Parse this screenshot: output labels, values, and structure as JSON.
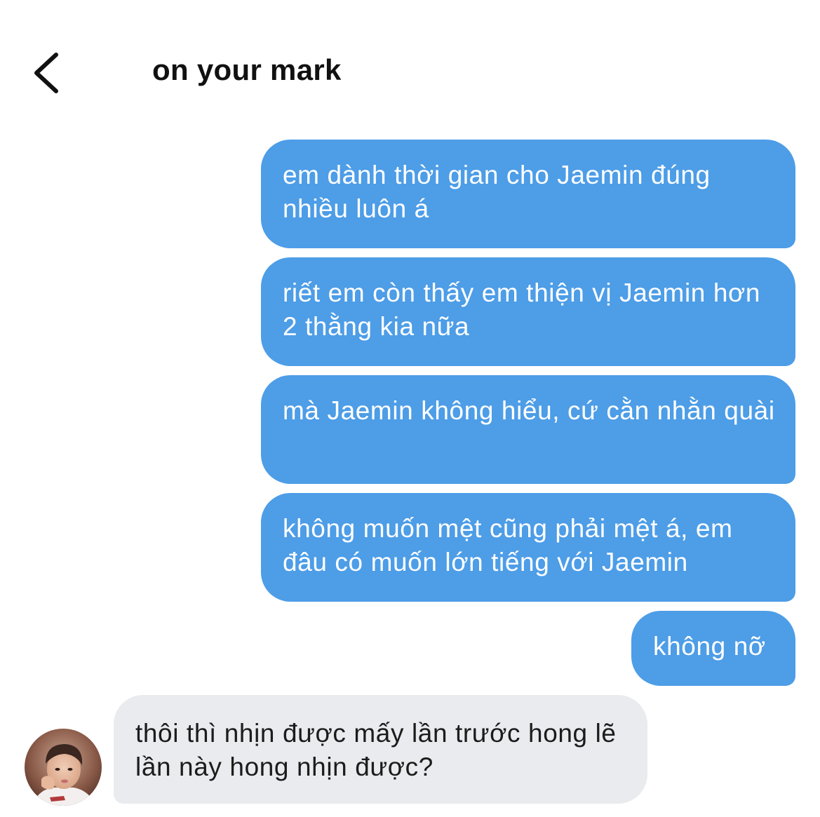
{
  "header": {
    "title": "on your mark",
    "back_icon": "chevron-left-icon"
  },
  "messages": [
    {
      "direction": "sent",
      "text": "em dành thời gian cho Jaemin đúng nhiều luôn á"
    },
    {
      "direction": "sent",
      "text": "riết em còn thấy em thiện vị Jaemin hơn 2 thằng kia nữa"
    },
    {
      "direction": "sent",
      "text": "mà Jaemin không hiểu, cứ cằn nhằn quài"
    },
    {
      "direction": "sent",
      "text": "không muốn mệt cũng phải mệt á, em đâu có muốn lớn tiếng với Jaemin"
    },
    {
      "direction": "sent",
      "text": "không nỡ"
    },
    {
      "direction": "received",
      "text": "thôi thì nhịn được mấy lần trước hong lẽ lần này hong nhịn được?"
    }
  ],
  "colors": {
    "sent_bubble": "#4d9de7",
    "received_bubble": "#e9ebee",
    "sent_text": "#ffffff",
    "received_text": "#1c1c1c"
  },
  "contact": {
    "avatar_icon": "avatar-photo"
  }
}
